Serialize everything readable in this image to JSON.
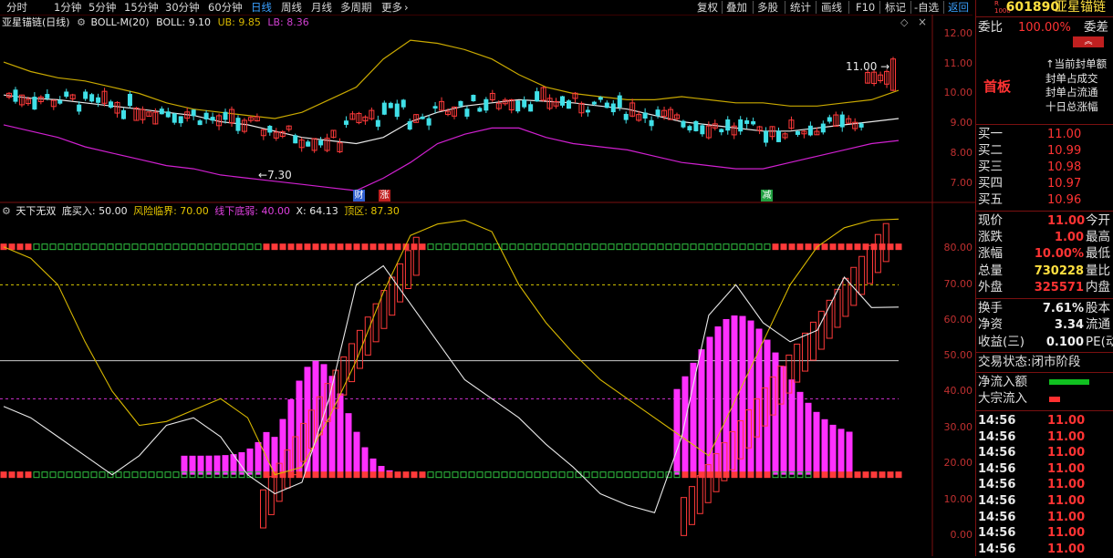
{
  "topbar": {
    "items": [
      "分时",
      "1分钟",
      "5分钟",
      "15分钟",
      "30分钟",
      "60分钟",
      "日线",
      "周线",
      "月线",
      "多周期",
      "更多"
    ],
    "active_index": 6,
    "right_items": [
      "复权",
      "叠加",
      "多股",
      "统计",
      "画线",
      "F10",
      "标记",
      "-自选",
      "返回"
    ],
    "more_arrow": "›"
  },
  "main_legend": {
    "name": "亚星锚链(日线)",
    "indicator": "BOLL-M(20)",
    "boll": "BOLL: 9.10",
    "ub": "UB: 9.85",
    "lb": "LB: 8.36"
  },
  "main_axis": [
    "12.00",
    "11.00",
    "10.00",
    "9.00",
    "8.00",
    "7.00"
  ],
  "main_annotations": {
    "high": "11.00",
    "low": "7.30"
  },
  "event_markers": [
    {
      "text": "财",
      "color": "#3060d0"
    },
    {
      "text": "涨",
      "color": "#c02020"
    },
    {
      "text": "减",
      "color": "#20a040"
    }
  ],
  "sub_legend": {
    "name": "天下无双",
    "buy": "底买入: 50.00",
    "risk": "风险临界: 70.00",
    "weak": "线下底弱: 40.00",
    "x": "X: 64.13",
    "top": "顶区: 87.30"
  },
  "sub_axis": [
    "80.00",
    "70.00",
    "60.00",
    "50.00",
    "40.00",
    "30.00",
    "20.00",
    "10.00",
    "0.00"
  ],
  "chart_data": [
    {
      "type": "candlestick",
      "title": "亚星锚链(日线)",
      "ylim": [
        6.6,
        12.3
      ],
      "series": [
        {
          "name": "BOLL",
          "values": [
            9.85,
            9.75,
            9.7,
            9.6,
            9.5,
            9.4,
            9.3,
            9.2,
            9.0,
            8.9,
            8.7,
            8.5,
            8.4,
            8.3,
            8.5,
            9.0,
            9.3,
            9.5,
            9.6,
            9.7,
            9.65,
            9.6,
            9.5,
            9.4,
            9.2,
            9.0,
            8.9,
            8.8,
            8.7,
            8.7,
            8.8,
            8.9,
            9.0,
            9.1
          ]
        },
        {
          "name": "UB",
          "values": [
            10.9,
            10.6,
            10.4,
            10.3,
            10.1,
            9.9,
            9.6,
            9.4,
            9.3,
            9.2,
            9.1,
            9.3,
            9.7,
            10.1,
            11.0,
            11.6,
            11.5,
            11.3,
            11.0,
            10.5,
            10.1,
            9.9,
            9.8,
            9.7,
            9.7,
            9.8,
            9.7,
            9.6,
            9.6,
            9.5,
            9.5,
            9.6,
            9.7,
            10.0
          ]
        },
        {
          "name": "LB",
          "values": [
            8.9,
            8.7,
            8.5,
            8.2,
            8.0,
            7.8,
            7.6,
            7.5,
            7.3,
            7.2,
            7.1,
            7.0,
            6.9,
            6.8,
            7.2,
            7.7,
            8.3,
            8.6,
            8.8,
            8.8,
            8.5,
            8.3,
            8.2,
            8.1,
            7.9,
            7.7,
            7.6,
            7.5,
            7.5,
            7.7,
            7.9,
            8.1,
            8.3,
            8.4
          ]
        }
      ]
    },
    {
      "type": "line",
      "title": "天下无双",
      "ylim": [
        0,
        90
      ],
      "series": [
        {
          "name": "顶区",
          "values": [
            80,
            77,
            70,
            55,
            42,
            33,
            34,
            37,
            40,
            35,
            20,
            22,
            35,
            50,
            68,
            83,
            86,
            87,
            84,
            70,
            60,
            52,
            45,
            40,
            35,
            30,
            25,
            40,
            55,
            70,
            80,
            85,
            87,
            87.3
          ]
        },
        {
          "name": "X",
          "values": [
            38,
            35,
            30,
            25,
            20,
            25,
            33,
            35,
            30,
            20,
            15,
            18,
            40,
            70,
            75,
            65,
            55,
            45,
            40,
            35,
            28,
            22,
            15,
            12,
            10,
            30,
            62,
            70,
            60,
            55,
            58,
            72,
            64,
            64.13
          ]
        }
      ]
    }
  ],
  "right_panel": {
    "code": "601890",
    "name": "亚星锚链",
    "code_prefix": "R\n1000",
    "weibi": {
      "label": "委比",
      "value": "100.00%",
      "extra": "委差"
    },
    "first_board": "首板",
    "seal_lines": [
      "当前封单额",
      "封单占成交",
      "封单占流通",
      "十日总涨幅"
    ],
    "bids": [
      {
        "label": "买一",
        "price": "11.00"
      },
      {
        "label": "买二",
        "price": "10.99"
      },
      {
        "label": "买三",
        "price": "10.98"
      },
      {
        "label": "买四",
        "price": "10.97"
      },
      {
        "label": "买五",
        "price": "10.96"
      }
    ],
    "stats": [
      {
        "label": "现价",
        "value": "11.00",
        "extra": "今开",
        "color": "red"
      },
      {
        "label": "涨跌",
        "value": "1.00",
        "extra": "最高",
        "color": "red"
      },
      {
        "label": "涨幅",
        "value": "10.00%",
        "extra": "最低",
        "color": "red"
      },
      {
        "label": "总量",
        "value": "730228",
        "extra": "量比",
        "color": "yel"
      },
      {
        "label": "外盘",
        "value": "325571",
        "extra": "内盘",
        "color": "red"
      },
      {
        "label": "换手",
        "value": "7.61%",
        "extra": "股本",
        "color": "wht"
      },
      {
        "label": "净资",
        "value": "3.34",
        "extra": "流通",
        "color": "wht"
      },
      {
        "label": "收益(三)",
        "value": "0.100",
        "extra": "PE(动",
        "color": "wht"
      }
    ],
    "trade_status": "交易状态:闭市阶段",
    "net_inflow": "净流入额",
    "block_inflow": "大宗流入",
    "ticks": [
      {
        "time": "14:56",
        "price": "11.00"
      },
      {
        "time": "14:56",
        "price": "11.00"
      },
      {
        "time": "14:56",
        "price": "11.00"
      },
      {
        "time": "14:56",
        "price": "11.00"
      },
      {
        "time": "14:56",
        "price": "11.00"
      },
      {
        "time": "14:56",
        "price": "11.00"
      },
      {
        "time": "14:56",
        "price": "11.00"
      },
      {
        "time": "14:56",
        "price": "11.00"
      },
      {
        "time": "14:56",
        "price": "11.00"
      }
    ]
  },
  "colors": {
    "up": "#ff3a3a",
    "down": "#40e0e8",
    "ub": "#c8a800",
    "boll": "#e8e8e8",
    "lb": "#d020d0",
    "magenta_bar": "#ff30ff",
    "green_box": "#30c040",
    "axis": "#c03030"
  }
}
